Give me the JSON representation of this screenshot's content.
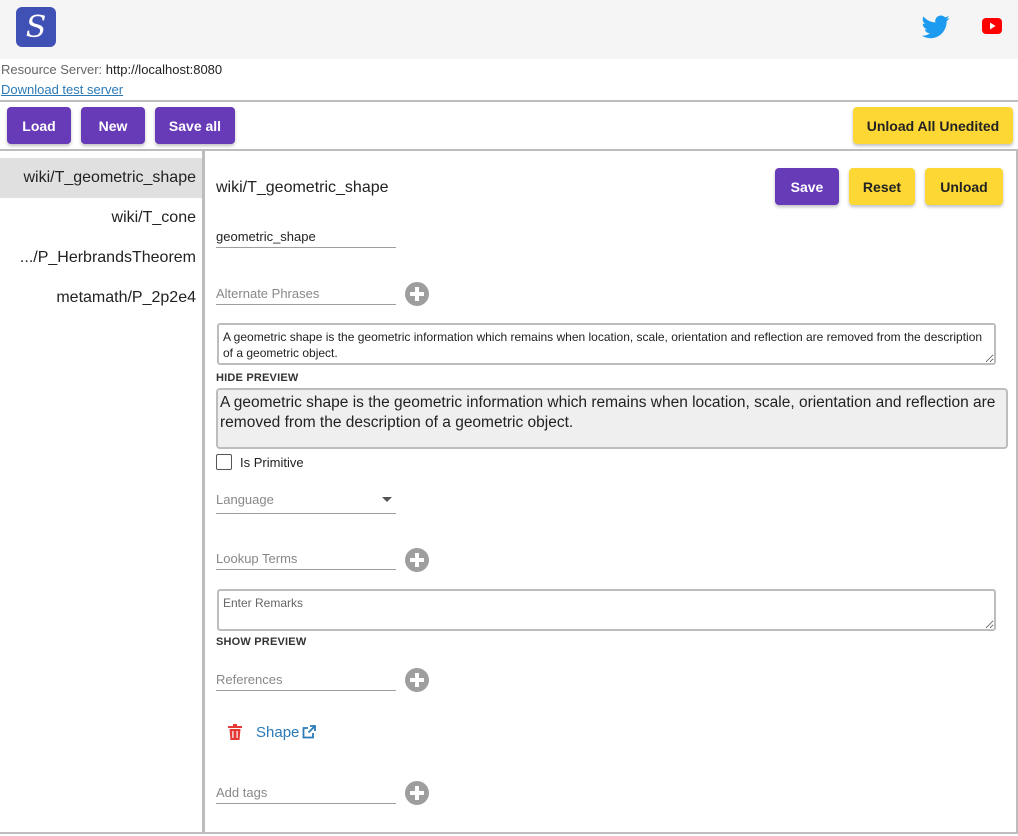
{
  "header": {
    "logo_letter": "S",
    "social": [
      "twitter-icon",
      "youtube-icon"
    ],
    "colors": {
      "twitter": "#1d9bf0",
      "youtube": "#ff0000",
      "logo_bg": "#3f51b5"
    }
  },
  "resource_server": {
    "label": "Resource Server:",
    "value": "http://localhost:8080"
  },
  "download_link": "Download test server",
  "toolbar": {
    "load": "Load",
    "new": "New",
    "save_all": "Save all",
    "unload_all": "Unload All Unedited"
  },
  "sidebar": {
    "items": [
      {
        "label": "wiki/T_geometric_shape",
        "active": true
      },
      {
        "label": "wiki/T_cone",
        "active": false
      },
      {
        "label": ".../P_HerbrandsTheorem",
        "active": false
      },
      {
        "label": "metamath/P_2p2e4",
        "active": false
      }
    ]
  },
  "editor": {
    "title": "wiki/T_geometric_shape",
    "save": "Save",
    "reset": "Reset",
    "unload": "Unload",
    "name_value": "geometric_shape",
    "alt_phrases_placeholder": "Alternate Phrases",
    "description": "A geometric shape is the geometric information which remains when location, scale, orientation and reflection are removed from the description of a geometric object.",
    "hide_preview": "HIDE PREVIEW",
    "preview_text": "A geometric shape is the geometric information which remains when location, scale, orientation and reflection are removed from the description of a geometric object.",
    "is_primitive": "Is Primitive",
    "language_placeholder": "Language",
    "lookup_placeholder": "Lookup Terms",
    "remarks_placeholder": "Enter Remarks",
    "show_preview": "SHOW PREVIEW",
    "references_placeholder": "References",
    "reference_link": "Shape",
    "tags_placeholder": "Add tags"
  },
  "colors": {
    "primary": "#673ab7",
    "secondary": "#fdd835",
    "link": "#2a7ab8",
    "delete": "#e53935"
  }
}
